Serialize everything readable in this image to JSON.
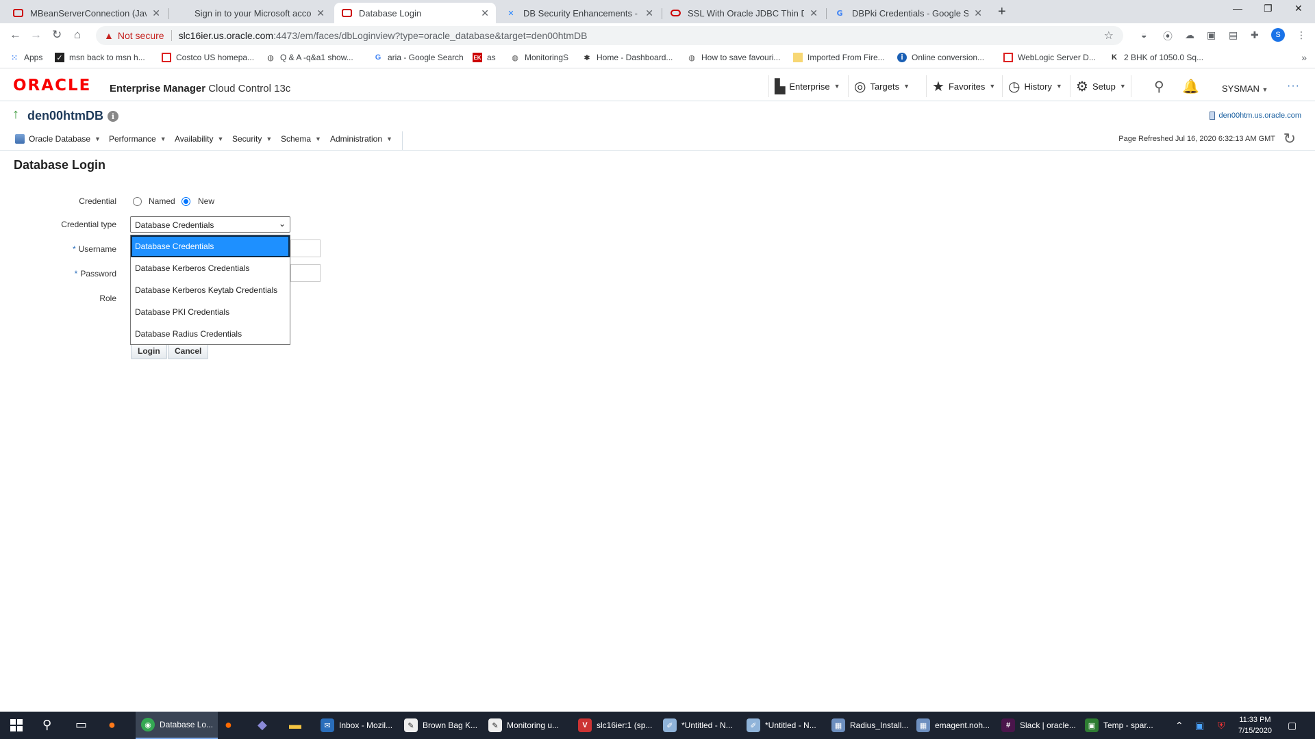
{
  "browser": {
    "tabs": [
      {
        "title": "MBeanServerConnection (Java Pl",
        "icon": "oracle-icon",
        "active": false
      },
      {
        "title": "Sign in to your Microsoft accoun",
        "icon": "microsoft-icon",
        "active": false
      },
      {
        "title": "Database Login",
        "icon": "oracle-icon",
        "active": true
      },
      {
        "title": "DB Security Enhancements - Sree",
        "icon": "confluence-icon",
        "active": false
      },
      {
        "title": "SSL With Oracle JDBC Thin Driver",
        "icon": "oracle-ring-icon",
        "active": false
      },
      {
        "title": "DBPki Credentials - Google Searc",
        "icon": "google-icon",
        "active": false
      }
    ],
    "not_secure": "Not secure",
    "url_host": "slc16ier.us.oracle.com",
    "url_rest": ":4473/em/faces/dbLoginview?type=oracle_database&target=den00htmDB",
    "profile_initial": "S",
    "bookmarks": [
      {
        "label": "Apps",
        "icon": "apps-grid-icon"
      },
      {
        "label": "msn back to msn h...",
        "icon": "msn-icon"
      },
      {
        "label": "Costco US homepa...",
        "icon": "costco-icon"
      },
      {
        "label": "Q & A -q&a1 show...",
        "icon": "globe-icon"
      },
      {
        "label": "aria - Google Search",
        "icon": "google-icon"
      },
      {
        "label": "as",
        "icon": "ek-icon"
      },
      {
        "label": "MonitoringS",
        "icon": "globe-icon"
      },
      {
        "label": "Home - Dashboard...",
        "icon": "jira-icon"
      },
      {
        "label": "How to save favouri...",
        "icon": "globe-icon"
      },
      {
        "label": "Imported From Fire...",
        "icon": "folder-icon"
      },
      {
        "label": "Online conversion...",
        "icon": "info-icon"
      },
      {
        "label": "WebLogic Server D...",
        "icon": "oracle-icon"
      },
      {
        "label": "2 BHK of 1050.0 Sq...",
        "icon": "k-icon"
      }
    ]
  },
  "em": {
    "logo": "ORACLE",
    "product_bold": "Enterprise Manager",
    "product_rest": "Cloud Control 13c",
    "nav": [
      {
        "label": "Enterprise",
        "icon": "enterprise-icon"
      },
      {
        "label": "Targets",
        "icon": "targets-icon"
      },
      {
        "label": "Favorites",
        "icon": "star-icon"
      },
      {
        "label": "History",
        "icon": "clock-icon"
      },
      {
        "label": "Setup",
        "icon": "gear-icon"
      }
    ],
    "user": "SYSMAN"
  },
  "target": {
    "name": "den00htmDB",
    "host": "den00htm.us.oracle.com",
    "menus": [
      "Oracle Database",
      "Performance",
      "Availability",
      "Security",
      "Schema",
      "Administration"
    ],
    "page_refreshed": "Page Refreshed Jul 16, 2020 6:32:13 AM GMT"
  },
  "form": {
    "heading": "Database Login",
    "credential_label": "Credential",
    "credential_options": [
      "Named",
      "New"
    ],
    "credential_selected": "New",
    "credential_type_label": "Credential type",
    "credential_type_value": "Database Credentials",
    "credential_type_options": [
      "Database Credentials",
      "Database Kerberos Credentials",
      "Database Kerberos Keytab Credentials",
      "Database PKI Credentials",
      "Database Radius Credentials"
    ],
    "username_label": "Username",
    "password_label": "Password",
    "role_label": "Role",
    "required_mark": "*",
    "login_button": "Login",
    "cancel_button": "Cancel"
  },
  "taskbar": {
    "apps": [
      {
        "label": "Database Lo...",
        "active": true
      },
      {
        "label": "Inbox - Mozil...",
        "active": false
      },
      {
        "label": "Brown Bag K...",
        "active": false
      },
      {
        "label": "Monitoring u...",
        "active": false
      },
      {
        "label": "slc16ier:1 (sp...",
        "active": false
      },
      {
        "label": "*Untitled - N...",
        "active": false
      },
      {
        "label": "*Untitled - N...",
        "active": false
      },
      {
        "label": "Radius_Install...",
        "active": false
      },
      {
        "label": "emagent.noh...",
        "active": false
      },
      {
        "label": "Slack | oracle...",
        "active": false
      },
      {
        "label": "Temp - spar...",
        "active": false
      }
    ],
    "time": "11:33 PM",
    "date": "7/15/2020"
  }
}
